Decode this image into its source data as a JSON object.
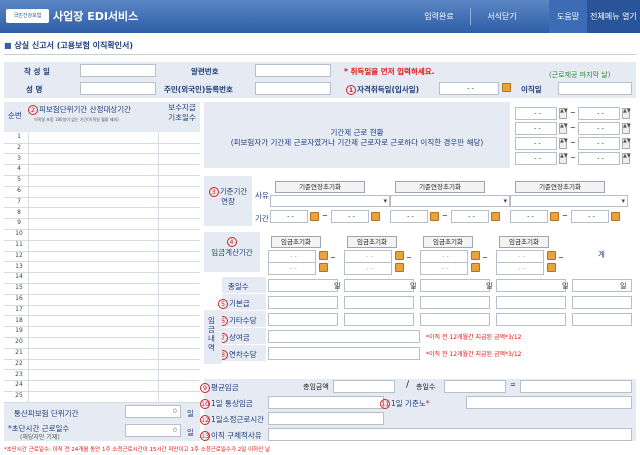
{
  "header": {
    "logo_text": "국민건강보험",
    "title": "사업장 EDI서비스",
    "buttons": [
      "입력완료",
      "서식닫기",
      "도움말",
      "전체메뉴 열기"
    ]
  },
  "section_title": "상실 신고서 (고용보험 이직확인서)",
  "top_form": {
    "write_date_label": "작 성 일",
    "notice_no_label": "알련번호",
    "warning": "* 취득일을 먼저 입력하세요.",
    "last_day_note": "(근로제공 마지막 날)",
    "name_label": "성 명",
    "rrn_label": "주민(외국인)등록번호",
    "acquire_label": "자격취득일(입사일)",
    "acquire_value": "- -",
    "leave_label": "이직일"
  },
  "left_table": {
    "seq_label": "순번",
    "period_label": "피보험단위기간 산정대상기간",
    "period_note": "이직일 포함 180일이 없는 기간(이직일 월을 제외)",
    "pay_days_label": "보수지급 기초일수",
    "rows": [
      "1",
      "2",
      "3",
      "4",
      "5",
      "6",
      "7",
      "8",
      "9",
      "10",
      "11",
      "12",
      "13",
      "14",
      "15",
      "16",
      "17",
      "18",
      "19",
      "20",
      "21",
      "22",
      "23",
      "24",
      "25"
    ],
    "total_period_label": "통산피보험 단위기간",
    "total_period_value": "0",
    "total_period_unit": "일",
    "short_hours_label": "*초단시간 근로일수",
    "short_hours_sub": "(해당자만 기재)",
    "short_hours_value": "0",
    "short_hours_unit": "일"
  },
  "fixed_term": {
    "title": "기간제 근로 현황",
    "desc": "(피보험자가 기간제 근로자였거나 기간제 근로자로 근로하다 이직한 경우만 해당)"
  },
  "base_period": {
    "label": "기준기간연장",
    "reason_label": "사유",
    "period_label": "기간",
    "reset_button": "기준연장초기화"
  },
  "wage_period": {
    "label": "임금계산기간",
    "reset_button": "임금초기화",
    "total_label": "계"
  },
  "wage_rows": {
    "total_days_label": "총일수",
    "day_unit": "일",
    "base_pay_label": "기본급",
    "other_allow_label": "기타수당",
    "wage_detail_label": "임금내역",
    "bonus_label": "상여금",
    "bonus_note": "*이직 전 12개월간 지급된 금액*3/12",
    "annual_leave_label": "연차수당",
    "annual_note": "*이직 전 12개월간 지급된 금액*3/12"
  },
  "bottom": {
    "avg_wage_label": "평균임금",
    "total_wage_label": "총임금액",
    "slash": "/",
    "total_days_label": "총일수",
    "eq": "=",
    "daily_wage_label": "1일 통상임금",
    "daily_hours_label": "1일 기준노",
    "daily_hours_star": "*",
    "contract_hours_label": "1일소정근로시간",
    "reason_label": "이직 구체적사유"
  },
  "footnote": "*초단시간 근로일수: 이직 전 24개월 동안 1주 소정근로시간이 15시간 미만이고 1주 소정근로일수가 2일 이하인 날",
  "colors": {
    "header_top": "#5a86c4",
    "header_bottom": "#2f5ea6",
    "label_bg": "#e6ebf3",
    "accent_red": "#d11"
  }
}
